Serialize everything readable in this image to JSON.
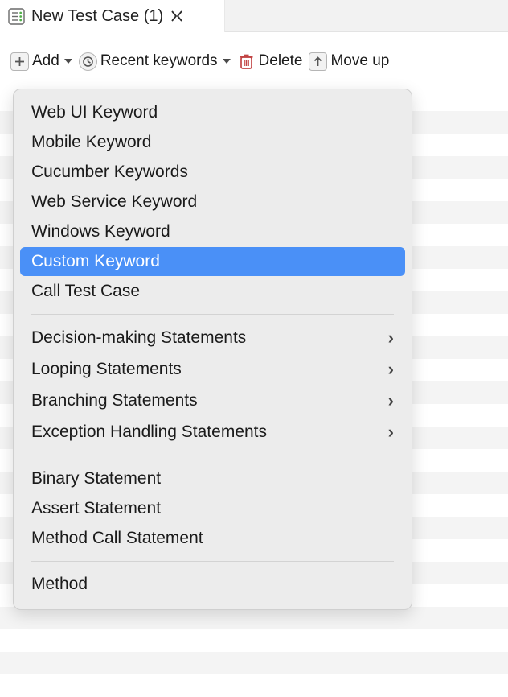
{
  "tab": {
    "label": "New Test Case (1)"
  },
  "toolbar": {
    "add_label": "Add",
    "recent_label": "Recent keywords",
    "delete_label": "Delete",
    "moveup_label": "Move up"
  },
  "menu": {
    "group1": [
      {
        "label": "Web UI Keyword",
        "selected": false
      },
      {
        "label": "Mobile Keyword",
        "selected": false
      },
      {
        "label": "Cucumber Keywords",
        "selected": false
      },
      {
        "label": "Web Service Keyword",
        "selected": false
      },
      {
        "label": "Windows Keyword",
        "selected": false
      },
      {
        "label": "Custom Keyword",
        "selected": true
      },
      {
        "label": "Call Test Case",
        "selected": false
      }
    ],
    "group2": [
      {
        "label": "Decision-making Statements",
        "has_submenu": true
      },
      {
        "label": "Looping Statements",
        "has_submenu": true
      },
      {
        "label": "Branching Statements",
        "has_submenu": true
      },
      {
        "label": "Exception Handling Statements",
        "has_submenu": true
      }
    ],
    "group3": [
      {
        "label": "Binary Statement"
      },
      {
        "label": "Assert Statement"
      },
      {
        "label": "Method Call Statement"
      }
    ],
    "group4": [
      {
        "label": "Method"
      }
    ]
  }
}
